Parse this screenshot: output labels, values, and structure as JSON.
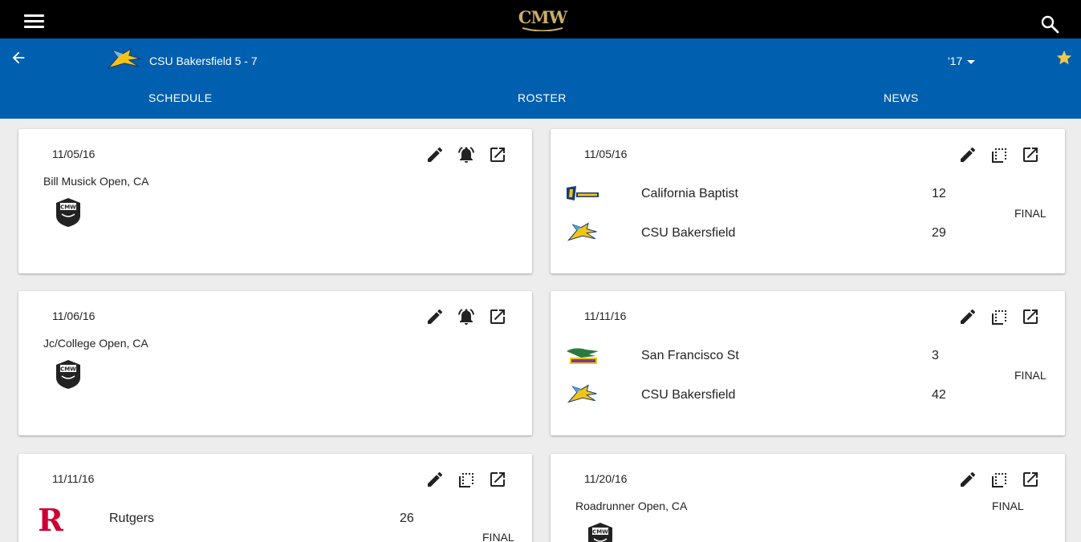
{
  "app": {
    "logo_text": "CMW",
    "colors": {
      "topbar": "#000000",
      "teambar": "#005faf",
      "accent_gold": "#c9ad6a",
      "star": "#f0c94a"
    }
  },
  "team": {
    "title": "CSU Bakersfield 5 - 7",
    "season": "'17"
  },
  "tabs": [
    {
      "label": "SCHEDULE"
    },
    {
      "label": "ROSTER"
    },
    {
      "label": "NEWS"
    }
  ],
  "cards": [
    {
      "type": "event",
      "date": "11/05/16",
      "location": "Bill Musick Open, CA",
      "icons": [
        "edit-icon",
        "bell-alarm-icon",
        "open-in-new-icon"
      ]
    },
    {
      "type": "game",
      "date": "11/05/16",
      "status": "FINAL",
      "teams": [
        {
          "name": "California Baptist",
          "score": "12",
          "logo": "lancers-logo"
        },
        {
          "name": "CSU Bakersfield",
          "score": "29",
          "logo": "roadrunners-logo"
        }
      ],
      "icons": [
        "edit-icon",
        "box-score-icon",
        "open-in-new-icon"
      ]
    },
    {
      "type": "event",
      "date": "11/06/16",
      "location": "Jc/College Open, CA",
      "icons": [
        "edit-icon",
        "bell-alarm-icon",
        "open-in-new-icon"
      ]
    },
    {
      "type": "game",
      "date": "11/11/16",
      "status": "FINAL",
      "teams": [
        {
          "name": "San Francisco St",
          "score": "3",
          "logo": "gators-logo"
        },
        {
          "name": "CSU Bakersfield",
          "score": "42",
          "logo": "roadrunners-logo"
        }
      ],
      "icons": [
        "edit-icon",
        "box-score-icon",
        "open-in-new-icon"
      ]
    },
    {
      "type": "game",
      "date": "11/11/16",
      "status": "FINAL",
      "teams": [
        {
          "name": "Rutgers",
          "score": "26",
          "logo": "rutgers-logo"
        }
      ],
      "icons": [
        "edit-icon",
        "box-score-icon",
        "open-in-new-icon"
      ]
    },
    {
      "type": "event",
      "date": "11/20/16",
      "location": "Roadrunner Open, CA",
      "status": "FINAL",
      "icons": [
        "edit-icon",
        "box-score-icon",
        "open-in-new-icon"
      ]
    }
  ]
}
